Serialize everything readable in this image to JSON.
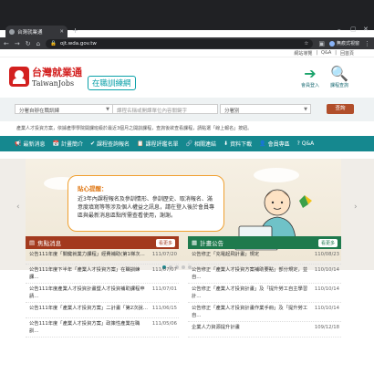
{
  "browser": {
    "tab_title": "台灣就業通",
    "url": "ojt.wda.gov.tw",
    "profile": "無痕式視窗"
  },
  "util": [
    "網站導覽",
    "Q&A",
    "回首頁"
  ],
  "header": {
    "logo_cn": "台灣就業通",
    "logo_en": "TaiwanJobs",
    "badge": "在職訓練網",
    "login": "會員登入",
    "course_search": "課程查詢"
  },
  "search": {
    "category": "分署自辦在職訓練",
    "placeholder": "課程名稱或開課單位內容關鍵字",
    "branch": "分署別",
    "button": "查詢"
  },
  "notice": "產業人才投資方案，依據產學學院開課班級於最近3個月之開訓課程，查詢後欲查看課程，請點選「線上報名」按鈕。",
  "nav": [
    {
      "icon": "📢",
      "label": "最新消息"
    },
    {
      "icon": "📅",
      "label": "計畫簡介"
    },
    {
      "icon": "✔",
      "label": "課程查詢報名"
    },
    {
      "icon": "📋",
      "label": "課程評鑑名單"
    },
    {
      "icon": "🔗",
      "label": "相關連結"
    },
    {
      "icon": "⬇",
      "label": "資料下載"
    },
    {
      "icon": "👤",
      "label": "會員專區"
    },
    {
      "icon": "?",
      "label": "Q&A"
    }
  ],
  "banner": {
    "title": "貼心提醒：",
    "body": "近3年內課程報名及參訓情形、參訓歷史、取消報名、滿意度填寫等等涉及個人權益之訊息，請在登入後於會員專區與最新消息區點所需查看使用，謝謝。",
    "slide_count": 5,
    "active_slide": 1
  },
  "news": {
    "title": "焦點消息",
    "more": "看更多",
    "items": [
      {
        "title": "公告111年度「關鍵就業力課程」經費補助(第1梯次…",
        "date": "111/07/20"
      },
      {
        "title": "公告111年度下半年「產業人才投資方案」在職訓練課…",
        "date": "111/07/07"
      },
      {
        "title": "公告111年度產業人才投資計畫暨人才投資補助課程申請…",
        "date": "111/07/01"
      },
      {
        "title": "公告111年度「產業人才投資方案」二計畫「第2次說…",
        "date": "111/06/15"
      },
      {
        "title": "公告111年度「產業人才投資方案」政策性產業在職訓…",
        "date": "111/05/06"
      }
    ]
  },
  "plans": {
    "title": "計畫公告",
    "more": "看更多",
    "items": [
      {
        "title": "公告修正「充電起飛計畫」規定",
        "date": "110/08/23"
      },
      {
        "title": "公告修正「產業人才投資方案補助要點」部分規定，並自…",
        "date": "110/10/14"
      },
      {
        "title": "公告修正「產業人才投資計畫」及「提升勞工自主學習計…",
        "date": "110/10/14"
      },
      {
        "title": "公告修正「產業人才投資計畫作業手冊」及「提升勞工自…",
        "date": "110/10/14"
      },
      {
        "title": "企業人力資源提升計畫",
        "date": "109/12/18"
      }
    ]
  }
}
